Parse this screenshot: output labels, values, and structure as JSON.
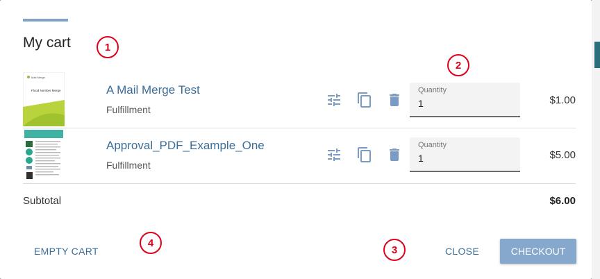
{
  "dialog": {
    "title": "My cart",
    "callouts": [
      "1",
      "2",
      "3",
      "4"
    ]
  },
  "cart": {
    "items": [
      {
        "name": "A Mail Merge Test",
        "type": "Fulfillment",
        "quantity_label": "Quantity",
        "quantity": "1",
        "price": "$1.00",
        "thumb_caption": "Flood Number Merge",
        "thumb_header": "Mail Merge"
      },
      {
        "name": "Approval_PDF_Example_One",
        "type": "Fulfillment",
        "quantity_label": "Quantity",
        "quantity": "1",
        "price": "$5.00"
      }
    ],
    "subtotal_label": "Subtotal",
    "subtotal_value": "$6.00"
  },
  "actions": {
    "empty_cart": "EMPTY CART",
    "close": "CLOSE",
    "checkout": "CHECKOUT"
  },
  "icons": {
    "options": "tune-icon",
    "duplicate": "copy-icon",
    "remove": "trash-icon"
  },
  "colors": {
    "accent": "#7fa3c8",
    "link": "#3b6e99",
    "primary_button": "#86a8cc",
    "callout": "#e0001a",
    "icon": "#7a9cc4"
  }
}
